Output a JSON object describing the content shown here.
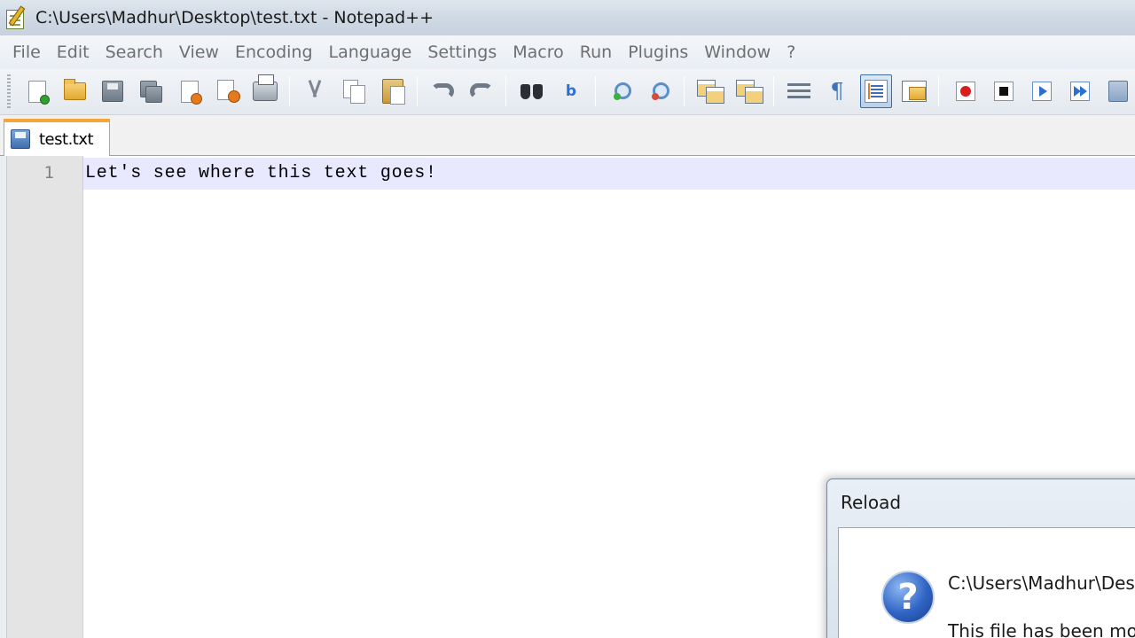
{
  "window": {
    "title": "C:\\Users\\Madhur\\Desktop\\test.txt - Notepad++",
    "app_icon": "notepad-plus-plus-icon"
  },
  "menubar": {
    "items": [
      "File",
      "Edit",
      "Search",
      "View",
      "Encoding",
      "Language",
      "Settings",
      "Macro",
      "Run",
      "Plugins",
      "Window",
      "?"
    ]
  },
  "toolbar": {
    "buttons": [
      {
        "name": "new-file",
        "icon": "new-file-icon"
      },
      {
        "name": "open-file",
        "icon": "open-folder-icon"
      },
      {
        "name": "save",
        "icon": "save-icon"
      },
      {
        "name": "save-all",
        "icon": "save-all-icon"
      },
      {
        "name": "close",
        "icon": "close-file-icon"
      },
      {
        "name": "close-all",
        "icon": "close-all-icon"
      },
      {
        "name": "print",
        "icon": "print-icon"
      },
      {
        "name": "cut",
        "icon": "cut-icon"
      },
      {
        "name": "copy",
        "icon": "copy-icon"
      },
      {
        "name": "paste",
        "icon": "paste-icon"
      },
      {
        "name": "undo",
        "icon": "undo-icon"
      },
      {
        "name": "redo",
        "icon": "redo-icon"
      },
      {
        "name": "find",
        "icon": "find-icon"
      },
      {
        "name": "replace",
        "icon": "replace-icon"
      },
      {
        "name": "zoom-in",
        "icon": "zoom-in-icon"
      },
      {
        "name": "zoom-out",
        "icon": "zoom-out-icon"
      },
      {
        "name": "sync-vertical",
        "icon": "sync-vertical-icon"
      },
      {
        "name": "sync-horizontal",
        "icon": "sync-horizontal-icon"
      },
      {
        "name": "word-wrap",
        "icon": "word-wrap-icon"
      },
      {
        "name": "show-all-characters",
        "icon": "pilcrow-icon"
      },
      {
        "name": "indent-guide",
        "icon": "indent-guide-icon",
        "active": true
      },
      {
        "name": "user-defined-language",
        "icon": "udl-icon"
      },
      {
        "name": "macro-record",
        "icon": "record-icon"
      },
      {
        "name": "macro-stop",
        "icon": "stop-icon"
      },
      {
        "name": "macro-play",
        "icon": "play-icon"
      },
      {
        "name": "macro-run-multiple",
        "icon": "play-multiple-icon"
      },
      {
        "name": "macro-save",
        "icon": "save-macro-icon"
      }
    ]
  },
  "tabs": [
    {
      "label": "test.txt",
      "icon": "saved-file-icon",
      "active": true
    }
  ],
  "editor": {
    "line_numbers": [
      "1"
    ],
    "lines": [
      "Let's see where this text goes!"
    ]
  },
  "dialog": {
    "title": "Reload",
    "icon": "question-icon",
    "path_text": "C:\\Users\\Madhur\\Des",
    "message_text": "This file has been mo"
  },
  "colors": {
    "tab_accent": "#f7a53a",
    "current_line_bg": "#e8e8ff",
    "gutter_bg": "#e4e4e4"
  }
}
